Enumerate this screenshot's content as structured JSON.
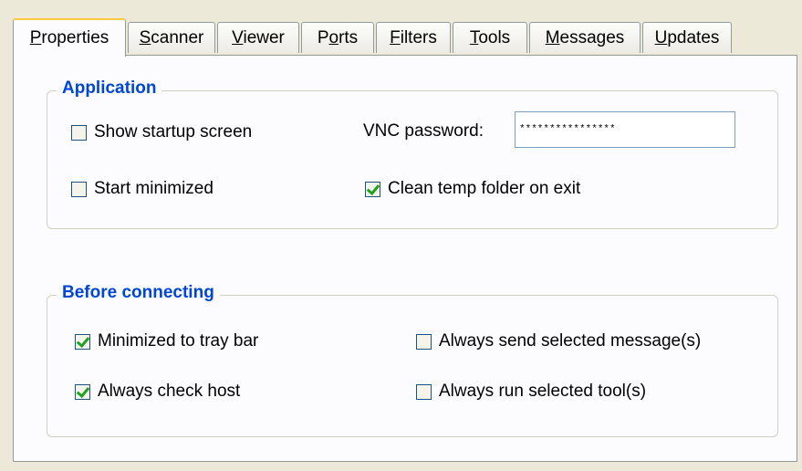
{
  "tabs": [
    {
      "label_pre": "",
      "accel": "P",
      "label_post": "roperties",
      "active": true
    },
    {
      "label_pre": "",
      "accel": "S",
      "label_post": "canner",
      "active": false
    },
    {
      "label_pre": "",
      "accel": "V",
      "label_post": "iewer",
      "active": false
    },
    {
      "label_pre": "P",
      "accel": "o",
      "label_post": "rts",
      "active": false
    },
    {
      "label_pre": "",
      "accel": "F",
      "label_post": "ilters",
      "active": false
    },
    {
      "label_pre": "",
      "accel": "T",
      "label_post": "ools",
      "active": false
    },
    {
      "label_pre": "",
      "accel": "M",
      "label_post": "essages",
      "active": false
    },
    {
      "label_pre": "",
      "accel": "U",
      "label_post": "pdates",
      "active": false
    }
  ],
  "application": {
    "legend": "Application",
    "show_startup_screen": {
      "label": "Show startup screen",
      "checked": false
    },
    "start_minimized": {
      "label": "Start minimized",
      "checked": false
    },
    "vnc_password_label": "VNC password:",
    "vnc_password_value": "****************",
    "clean_temp": {
      "label": "Clean temp folder on exit",
      "checked": true
    }
  },
  "before_connecting": {
    "legend": "Before connecting",
    "minimized_tray": {
      "label": "Minimized to tray bar",
      "checked": true
    },
    "always_check_host": {
      "label": "Always check host",
      "checked": true
    },
    "always_send_messages": {
      "label": "Always send selected message(s)",
      "checked": false
    },
    "always_run_tools": {
      "label": "Always run selected tool(s)",
      "checked": false
    }
  }
}
